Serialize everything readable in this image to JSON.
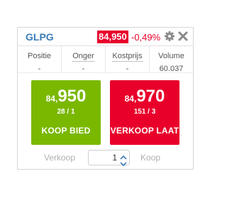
{
  "header": {
    "symbol": "GLPG",
    "last_price": "84,950",
    "change": "-0,49%",
    "icons": {
      "settings": "gear-icon",
      "close": "close-icon"
    },
    "colors": {
      "symbol": "#3b7cb8",
      "negative": "#e8002b"
    }
  },
  "stats": [
    {
      "label": "Positie",
      "value": "-"
    },
    {
      "label": "Onger",
      "value": "-"
    },
    {
      "label": "Kostprijs",
      "value": "-"
    },
    {
      "label": "Volume",
      "value": "60.037"
    }
  ],
  "buy": {
    "price_small": "84,",
    "price_big": "950",
    "volume": "28 / 1",
    "label": "KOOP BIED",
    "color": "#7ab800"
  },
  "sell": {
    "price_small": "84,",
    "price_big": "970",
    "volume": "151 / 3",
    "label": "VERKOOP LAAT",
    "color": "#e8002b"
  },
  "quantity": {
    "left_label": "Verkoop",
    "value": "1",
    "right_label": "Koop"
  }
}
